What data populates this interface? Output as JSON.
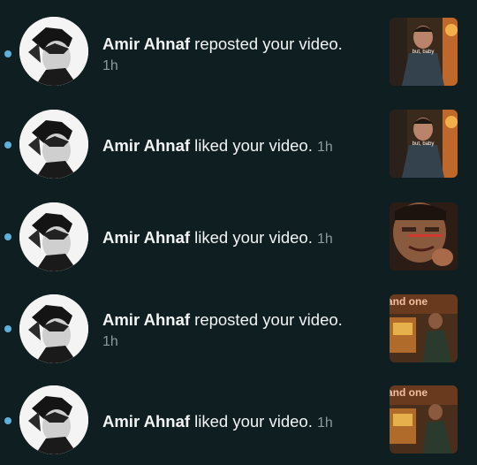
{
  "notifications": [
    {
      "user": "Amir Ahnaf",
      "action": "reposted your video.",
      "time": "1h",
      "thumb": "ninja-dark",
      "unread": true
    },
    {
      "user": "Amir Ahnaf",
      "action": "liked your video.",
      "time": "1h",
      "thumb": "ninja-dark",
      "unread": true
    },
    {
      "user": "Amir Ahnaf",
      "action": "liked your video.",
      "time": "1h",
      "thumb": "closeup-face",
      "unread": true
    },
    {
      "user": "Amir Ahnaf",
      "action": "reposted your video.",
      "time": "1h",
      "thumb": "arcade",
      "unread": true
    },
    {
      "user": "Amir Ahnaf",
      "action": "liked your video.",
      "time": "1h",
      "thumb": "arcade",
      "unread": true
    }
  ],
  "thumb_texts": {
    "ninja_caption": "but, baby",
    "arcade_sign": "and one"
  },
  "colors": {
    "background": "#0e1e21",
    "unread_dot": "#5fb0dc",
    "timestamp": "#8a9a9c"
  }
}
